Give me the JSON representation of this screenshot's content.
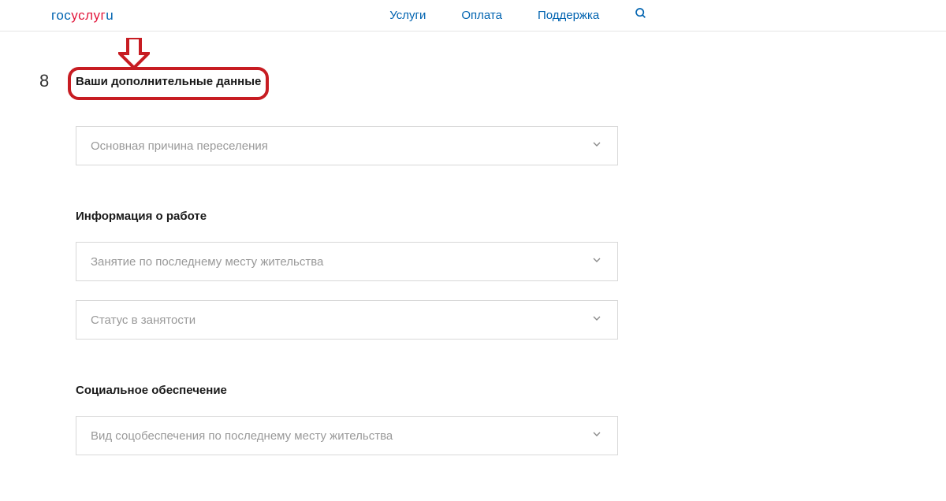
{
  "logo": {
    "part1": "гос",
    "part2": "услуг",
    "part3": "u"
  },
  "nav": {
    "services": "Услуги",
    "payment": "Оплата",
    "support": "Поддержка"
  },
  "step_number": "8",
  "section_title": "Ваши дополнительные данные",
  "dropdowns": {
    "reason": "Основная причина переселения",
    "occupation": "Занятие по последнему месту жительства",
    "employment_status": "Статус в занятости",
    "social_security": "Вид соцобеспечения по последнему месту жительства"
  },
  "subsections": {
    "work_info": "Информация о работе",
    "social_security": "Социальное обеспечение"
  }
}
